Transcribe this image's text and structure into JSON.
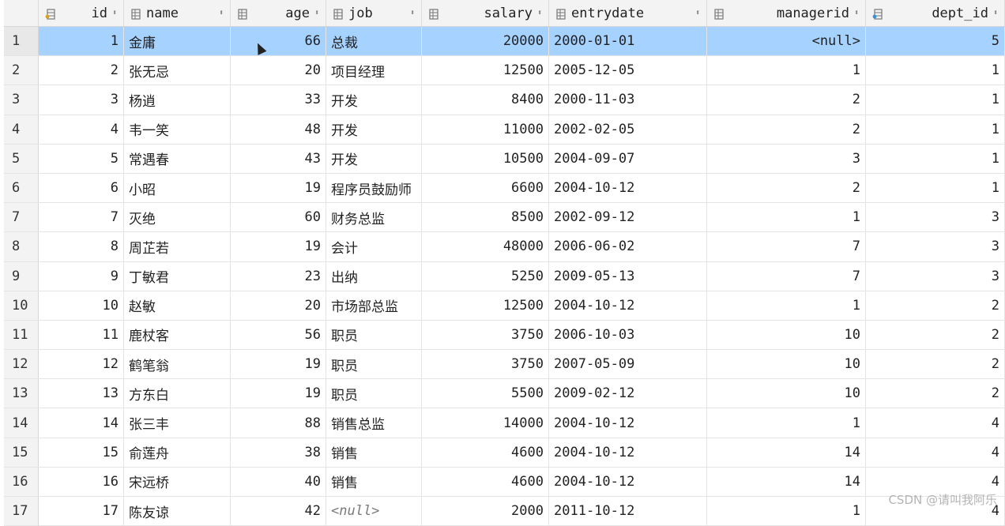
{
  "columns": [
    {
      "key": "id",
      "label": "id",
      "icon": "primary-key-column-icon"
    },
    {
      "key": "name",
      "label": "name",
      "icon": "column-icon"
    },
    {
      "key": "age",
      "label": "age",
      "icon": "column-icon"
    },
    {
      "key": "job",
      "label": "job",
      "icon": "column-icon"
    },
    {
      "key": "salary",
      "label": "salary",
      "icon": "column-icon"
    },
    {
      "key": "entrydate",
      "label": "entrydate",
      "icon": "column-icon"
    },
    {
      "key": "managerid",
      "label": "managerid",
      "icon": "column-icon"
    },
    {
      "key": "dept_id",
      "label": "dept_id",
      "icon": "foreign-key-column-icon"
    }
  ],
  "sort_glyph": "⬍",
  "null_text": "<null>",
  "rows": [
    {
      "rn": "1",
      "id": "1",
      "name": "金庸",
      "age": "66",
      "job": "总裁",
      "salary": "20000",
      "entrydate": "2000-01-01",
      "managerid": "<null>",
      "dept_id": "5",
      "selected": true
    },
    {
      "rn": "2",
      "id": "2",
      "name": "张无忌",
      "age": "20",
      "job": "项目经理",
      "salary": "12500",
      "entrydate": "2005-12-05",
      "managerid": "1",
      "dept_id": "1"
    },
    {
      "rn": "3",
      "id": "3",
      "name": "杨逍",
      "age": "33",
      "job": "开发",
      "salary": "8400",
      "entrydate": "2000-11-03",
      "managerid": "2",
      "dept_id": "1"
    },
    {
      "rn": "4",
      "id": "4",
      "name": "韦一笑",
      "age": "48",
      "job": "开发",
      "salary": "11000",
      "entrydate": "2002-02-05",
      "managerid": "2",
      "dept_id": "1"
    },
    {
      "rn": "5",
      "id": "5",
      "name": "常遇春",
      "age": "43",
      "job": "开发",
      "salary": "10500",
      "entrydate": "2004-09-07",
      "managerid": "3",
      "dept_id": "1"
    },
    {
      "rn": "6",
      "id": "6",
      "name": "小昭",
      "age": "19",
      "job": "程序员鼓励师",
      "salary": "6600",
      "entrydate": "2004-10-12",
      "managerid": "2",
      "dept_id": "1"
    },
    {
      "rn": "7",
      "id": "7",
      "name": "灭绝",
      "age": "60",
      "job": "财务总监",
      "salary": "8500",
      "entrydate": "2002-09-12",
      "managerid": "1",
      "dept_id": "3"
    },
    {
      "rn": "8",
      "id": "8",
      "name": "周芷若",
      "age": "19",
      "job": "会计",
      "salary": "48000",
      "entrydate": "2006-06-02",
      "managerid": "7",
      "dept_id": "3"
    },
    {
      "rn": "9",
      "id": "9",
      "name": "丁敏君",
      "age": "23",
      "job": "出纳",
      "salary": "5250",
      "entrydate": "2009-05-13",
      "managerid": "7",
      "dept_id": "3"
    },
    {
      "rn": "10",
      "id": "10",
      "name": "赵敏",
      "age": "20",
      "job": "市场部总监",
      "salary": "12500",
      "entrydate": "2004-10-12",
      "managerid": "1",
      "dept_id": "2"
    },
    {
      "rn": "11",
      "id": "11",
      "name": "鹿杖客",
      "age": "56",
      "job": "职员",
      "salary": "3750",
      "entrydate": "2006-10-03",
      "managerid": "10",
      "dept_id": "2"
    },
    {
      "rn": "12",
      "id": "12",
      "name": "鹤笔翁",
      "age": "19",
      "job": "职员",
      "salary": "3750",
      "entrydate": "2007-05-09",
      "managerid": "10",
      "dept_id": "2"
    },
    {
      "rn": "13",
      "id": "13",
      "name": "方东白",
      "age": "19",
      "job": "职员",
      "salary": "5500",
      "entrydate": "2009-02-12",
      "managerid": "10",
      "dept_id": "2"
    },
    {
      "rn": "14",
      "id": "14",
      "name": "张三丰",
      "age": "88",
      "job": "销售总监",
      "salary": "14000",
      "entrydate": "2004-10-12",
      "managerid": "1",
      "dept_id": "4"
    },
    {
      "rn": "15",
      "id": "15",
      "name": "俞莲舟",
      "age": "38",
      "job": "销售",
      "salary": "4600",
      "entrydate": "2004-10-12",
      "managerid": "14",
      "dept_id": "4"
    },
    {
      "rn": "16",
      "id": "16",
      "name": "宋远桥",
      "age": "40",
      "job": "销售",
      "salary": "4600",
      "entrydate": "2004-10-12",
      "managerid": "14",
      "dept_id": "4"
    },
    {
      "rn": "17",
      "id": "17",
      "name": "陈友谅",
      "age": "42",
      "job": "<null>",
      "salary": "2000",
      "entrydate": "2011-10-12",
      "managerid": "1",
      "dept_id": "4"
    }
  ],
  "watermark": "CSDN @请叫我阿乐"
}
